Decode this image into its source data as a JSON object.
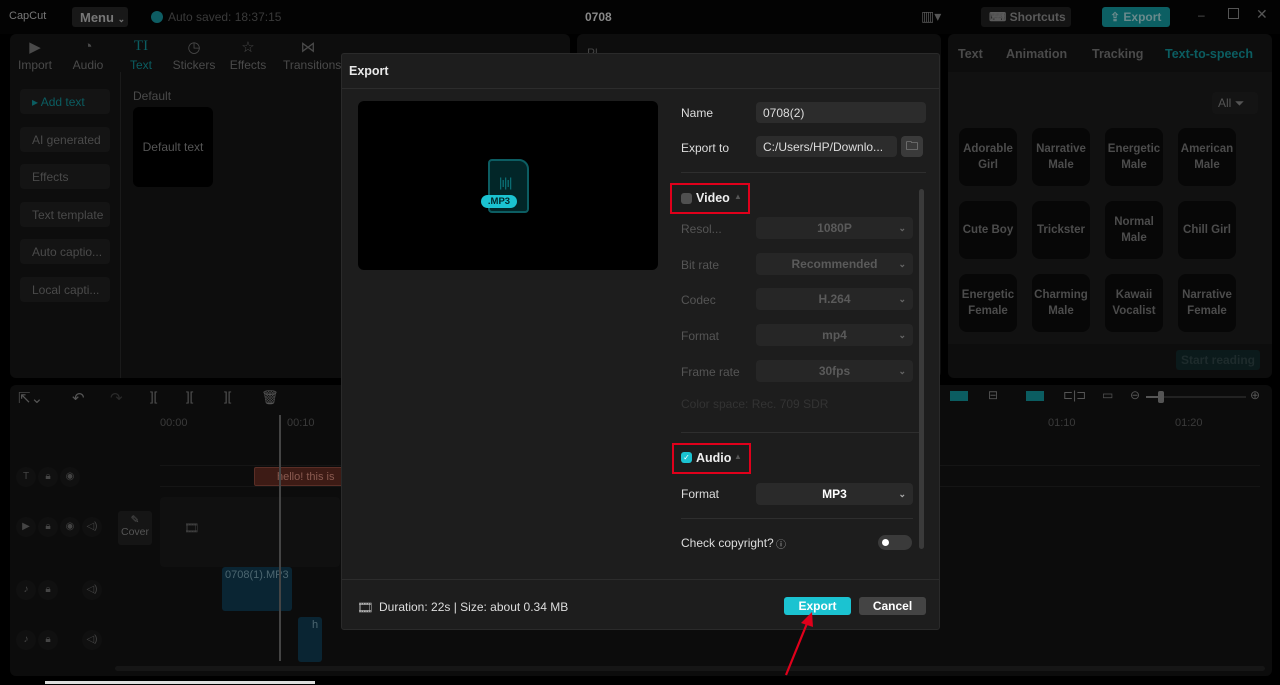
{
  "app": {
    "logo": "CapCut",
    "menu": "Menu",
    "autosave": "Auto saved: 18:37:15",
    "project_title": "0708",
    "shortcuts": "Shortcuts",
    "export": "Export"
  },
  "toolbar": [
    {
      "label": "Import",
      "icon": "import-icon"
    },
    {
      "label": "Audio",
      "icon": "audio-icon"
    },
    {
      "label": "Text",
      "icon": "text-icon",
      "active": true
    },
    {
      "label": "Stickers",
      "icon": "sticker-icon"
    },
    {
      "label": "Effects",
      "icon": "effects-icon"
    },
    {
      "label": "Transitions",
      "icon": "transitions-icon"
    }
  ],
  "sidebar": {
    "items": [
      "Add text",
      "AI generated",
      "Effects",
      "Text template",
      "Auto captio...",
      "Local capti..."
    ]
  },
  "text_library": {
    "section": "Default",
    "card": "Default text"
  },
  "player": {
    "label": "Pl"
  },
  "right_panel": {
    "tabs": [
      "Text",
      "Animation",
      "Tracking",
      "Text-to-speech"
    ],
    "filter": "All",
    "voices": [
      "Adorable Girl",
      "Narrative Male",
      "Energetic Male",
      "American Male",
      "Cute Boy",
      "Trickster",
      "Normal Male",
      "Chill Girl",
      "Energetic Female",
      "Charming Male",
      "Kawaii Vocalist",
      "Narrative Female"
    ],
    "start_reading": "Start reading"
  },
  "timeline": {
    "ticks": [
      "00:00",
      "00:10",
      "01:10",
      "01:20"
    ],
    "text_clip": "hello! this is",
    "audio_clip": "0708(1).MP3",
    "small_clip": "h",
    "cover": "Cover"
  },
  "export_dialog": {
    "title": "Export",
    "preview_badge": ".MP3",
    "name_label": "Name",
    "name_value": "0708(2)",
    "export_to_label": "Export to",
    "export_to_value": "C:/Users/HP/Downlo...",
    "video": {
      "label": "Video",
      "checked": false,
      "fields": [
        {
          "label": "Resol...",
          "value": "1080P"
        },
        {
          "label": "Bit rate",
          "value": "Recommended"
        },
        {
          "label": "Codec",
          "value": "H.264"
        },
        {
          "label": "Format",
          "value": "mp4"
        },
        {
          "label": "Frame rate",
          "value": "30fps"
        }
      ],
      "color_space": "Color space: Rec. 709 SDR"
    },
    "audio": {
      "label": "Audio",
      "checked": true,
      "format_label": "Format",
      "format_value": "MP3"
    },
    "copyright_label": "Check copyright?",
    "copyright_on": false,
    "summary": "Duration: 22s | Size: about 0.34 MB",
    "export_button": "Export",
    "cancel_button": "Cancel"
  },
  "colors": {
    "accent": "#1bc3d1",
    "highlight": "#e0001b",
    "dim_accent": "#0c5f63"
  }
}
